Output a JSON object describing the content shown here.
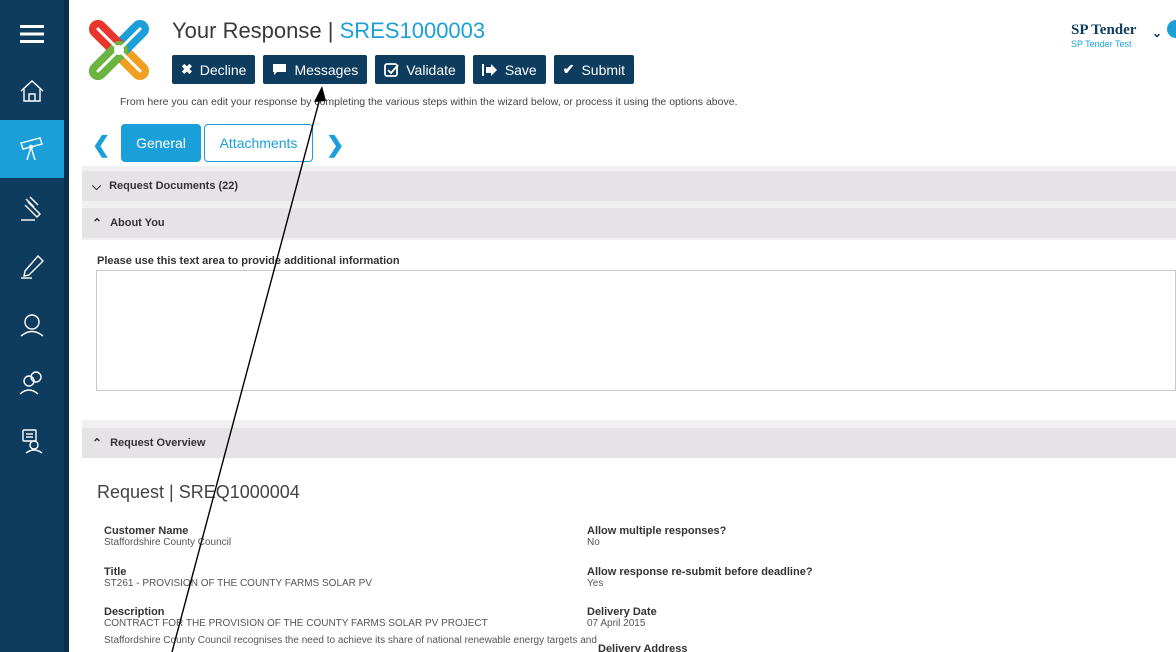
{
  "page": {
    "title_prefix": "Your Response | ",
    "title_code": "SRES1000003",
    "help_text": "From here you can edit your response by completing the various steps within the wizard below, or process it using the options above."
  },
  "toolbar": {
    "decline": "Decline",
    "messages": "Messages",
    "validate": "Validate",
    "save": "Save",
    "submit": "Submit"
  },
  "user": {
    "name": "SP Tender",
    "subtitle": "SP Tender Test"
  },
  "tabs": {
    "general": "General",
    "attachments": "Attachments"
  },
  "panels": {
    "request_documents": "Request Documents (22)",
    "about_you": "About You",
    "request_overview": "Request Overview"
  },
  "about_you": {
    "textarea_label": "Please use this text area to provide additional information",
    "textarea_value": ""
  },
  "request": {
    "title": "Request | SREQ1000004",
    "fields": {
      "customer_name_label": "Customer Name",
      "customer_name": "Staffordshire County Council",
      "title_label": "Title",
      "title_value": "ST261 - PROVISION OF THE COUNTY FARMS SOLAR PV",
      "description_label": "Description",
      "description_value": "CONTRACT FOR THE PROVISION OF THE COUNTY FARMS SOLAR PV PROJECT",
      "description_more": "Staffordshire County Council recognises the need to achieve its share of national renewable energy targets and",
      "allow_multiple_label": "Allow multiple responses?",
      "allow_multiple_value": "No",
      "allow_resubmit_label": "Allow response re-submit before deadline?",
      "allow_resubmit_value": "Yes",
      "delivery_date_label": "Delivery Date",
      "delivery_date_value": "07 April 2015",
      "delivery_address_label": "Delivery Address"
    }
  },
  "sidebar": {
    "items": [
      "menu-icon",
      "home-icon",
      "telescope-icon",
      "gavel-icon",
      "pen-icon",
      "user-icon",
      "users-icon",
      "chat-user-icon"
    ]
  },
  "colors": {
    "sidebar": "#0d3c5e",
    "accent": "#1a9fd9",
    "panel_header": "#e6e3e6"
  }
}
